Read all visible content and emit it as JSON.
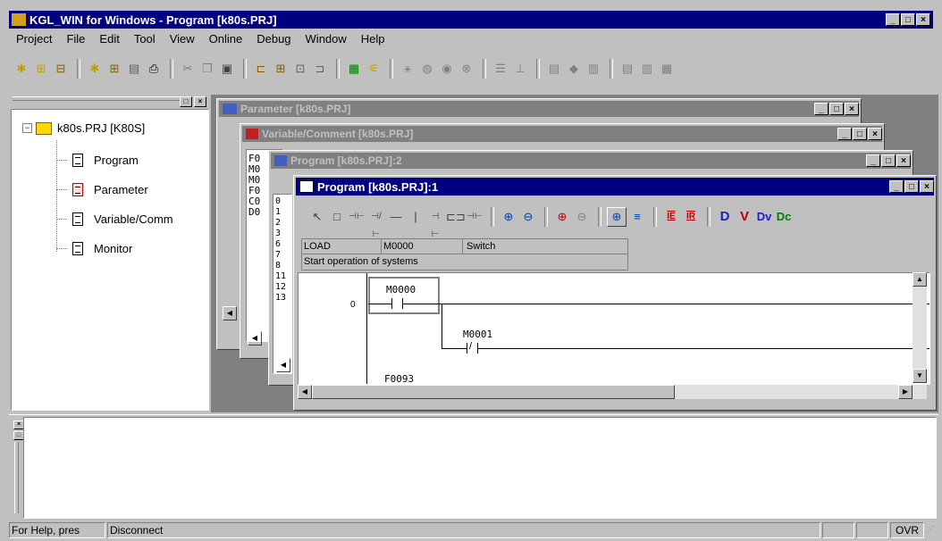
{
  "app": {
    "title": "KGL_WIN for Windows - Program [k80s.PRJ]"
  },
  "menu": [
    "Project",
    "File",
    "Edit",
    "Tool",
    "View",
    "Online",
    "Debug",
    "Window",
    "Help"
  ],
  "menu_underline": [
    "P",
    "F",
    "E",
    "T",
    "V",
    "O",
    "D",
    "W",
    "H"
  ],
  "toolbar": {
    "icons": [
      "new-project-icon",
      "open-project-icon",
      "close-project-icon",
      "new-program-icon",
      "open-program-icon",
      "save-icon",
      "print-icon",
      "cut-icon",
      "copy-icon",
      "paste-icon",
      "window-icon-1",
      "window-icon-2",
      "window-icon-3",
      "window-icon-4",
      "connect-icon",
      "link-icon",
      "run-icon",
      "stop-icon",
      "pause-icon",
      "reset-icon",
      "monitor-icon-1",
      "monitor-icon-2",
      "list-icon-1",
      "list-icon-2",
      "list-icon-3",
      "list-icon-4",
      "list-icon-5",
      "list-icon-6"
    ]
  },
  "project_tree": {
    "root": "k80s.PRJ [K80S]",
    "items": [
      "Program",
      "Parameter",
      "Variable/Comm",
      "Monitor"
    ]
  },
  "windows": {
    "parameter": "Parameter [k80s.PRJ]",
    "variable": "Variable/Comment [k80s.PRJ]",
    "program2": "Program [k80s.PRJ]:2",
    "program1": "Program [k80s.PRJ]:1"
  },
  "variable_rows": [
    "F0",
    "M0",
    "M0",
    "F0",
    "C0",
    "D0"
  ],
  "program2_rows": [
    "0",
    "1",
    "2",
    "3",
    "6",
    "7",
    "8",
    "11",
    "12",
    "13"
  ],
  "ladder_toolbar": [
    "↖",
    "□",
    "⊣⊢",
    "⊣/⊢",
    "—",
    "|",
    "⊣ ⊢",
    "⊏⊐",
    "⊣⊢",
    "⊕",
    "⊖",
    "⊕",
    "⊖",
    "⊕",
    "≡",
    "IE",
    "IR",
    "D",
    "V",
    "Dv",
    "Dc"
  ],
  "instruction": {
    "op": "LOAD",
    "device": "M0000",
    "comment": "Switch",
    "description": "Start operation of systems"
  },
  "ladder": {
    "step0": "0",
    "contact1": "M0000",
    "contact2": "M0001",
    "contact3": "F0093"
  },
  "status": {
    "help": "For Help, pres",
    "connection": "Disconnect",
    "ovr": "OVR"
  }
}
